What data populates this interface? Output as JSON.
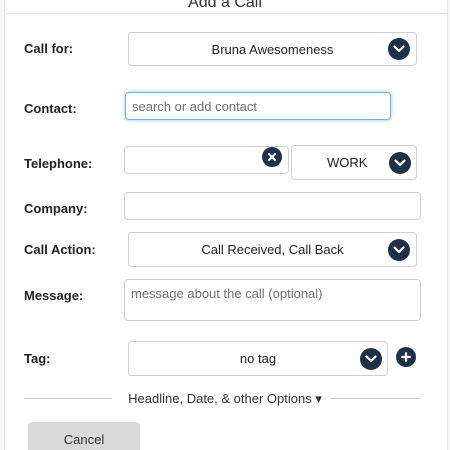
{
  "dialog": {
    "title": "Add a Call"
  },
  "fields": {
    "call_for": {
      "label": "Call for:",
      "value": "Bruna Awesomeness"
    },
    "contact": {
      "label": "Contact:",
      "placeholder": "search or add contact"
    },
    "telephone": {
      "label": "Telephone:",
      "value": "",
      "type_value": "WORK"
    },
    "company": {
      "label": "Company:",
      "value": ""
    },
    "call_action": {
      "label": "Call Action:",
      "value": "Call Received, Call Back"
    },
    "message": {
      "label": "Message:",
      "placeholder": "message about the call (optional)"
    },
    "tag": {
      "label": "Tag:",
      "value": "no tag"
    }
  },
  "options_toggle": {
    "label": "Headline, Date, & other Options ▾"
  },
  "buttons": {
    "cancel": "Cancel"
  },
  "icons": {
    "dropdown": "chevron-down-icon",
    "clear": "clear-x-icon",
    "add": "plus-icon"
  },
  "colors": {
    "icon_bg": "#1f3148",
    "focus_border": "#7aaee0",
    "cancel_bg": "#d9d9d9"
  }
}
